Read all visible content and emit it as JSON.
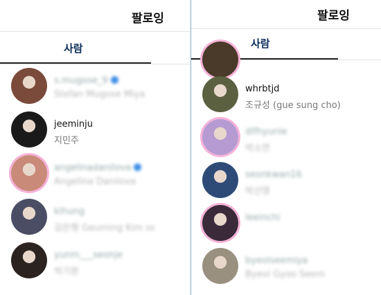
{
  "left": {
    "title": "팔로잉",
    "tab": "사람",
    "items": [
      {
        "username": "s.mugose_9",
        "name": "Stefan Mugose Miya",
        "verified": true,
        "blurred": true,
        "color": "#7a4a3a"
      },
      {
        "username": "jeeminju",
        "name": "지민주",
        "verified": false,
        "blurred": false,
        "color": "#1a1a1a"
      },
      {
        "username": "angelinadanilova",
        "name": "Angelina Danilova",
        "verified": true,
        "blurred": true,
        "color": "#c98a7a"
      },
      {
        "username": "kihung",
        "name": "김은행 Geuming Kim ss",
        "verified": false,
        "blurred": true,
        "color": "#4a4d63"
      },
      {
        "username": "yunm___seonje",
        "name": "박기원",
        "verified": false,
        "blurred": true,
        "color": "#2a2320"
      }
    ]
  },
  "right": {
    "title": "팔로잉",
    "tab": "사람",
    "items": [
      {
        "username": "whrbtjd",
        "name": "조규성 (gue sung cho)",
        "blurred": false,
        "color": "#5a6040"
      },
      {
        "username": "dlfhyunle",
        "name": "박소연",
        "blurred": true,
        "color": "#b59bd2"
      },
      {
        "username": "seonkwan16",
        "name": "박선영",
        "blurred": true,
        "color": "#2e4b78"
      },
      {
        "username": "leeinchi",
        "name": "",
        "blurred": true,
        "color": "#3a2a3a"
      },
      {
        "username": "byeolseemiya",
        "name": "Byeol Gyoo Seem",
        "blurred": true,
        "color": "#9a9080"
      }
    ]
  }
}
